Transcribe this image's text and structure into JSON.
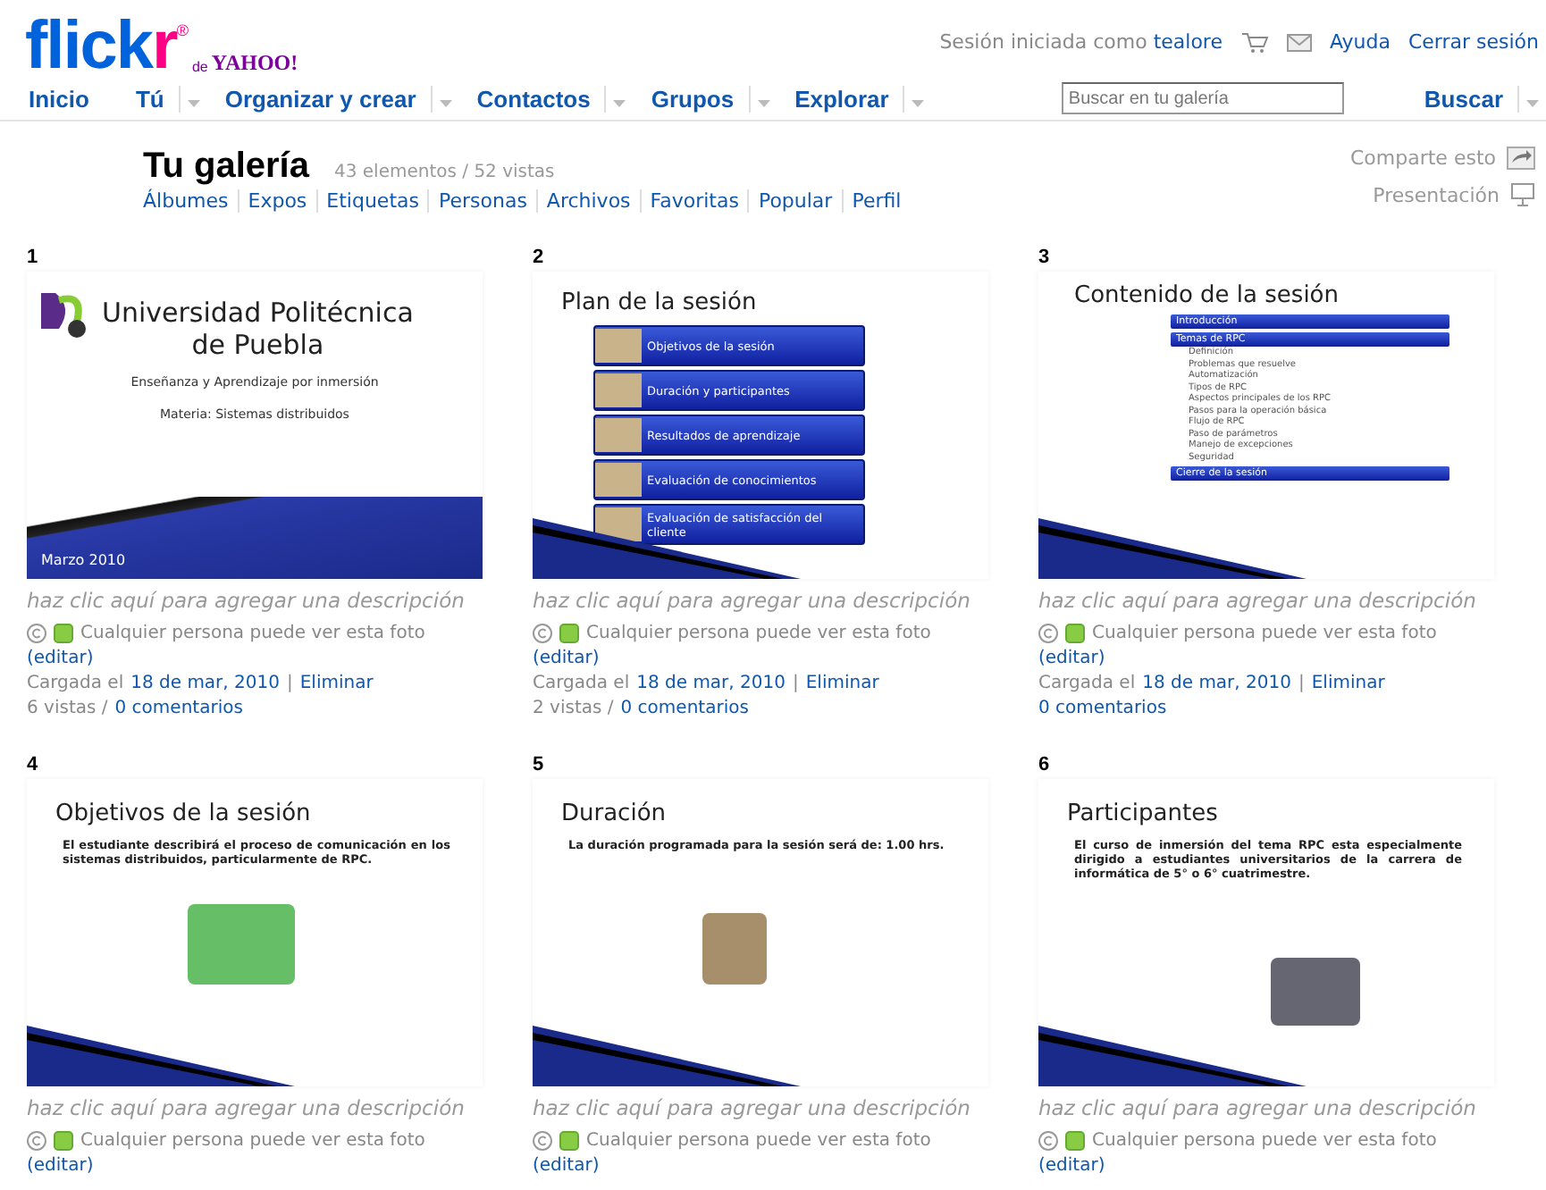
{
  "logo": {
    "word": "flick",
    "accent": "r",
    "mark": "®",
    "sub": "de",
    "brand": "YAHOO!"
  },
  "account": {
    "prefix": "Sesión iniciada como",
    "user": "tealore",
    "help": "Ayuda",
    "logout": "Cerrar sesión"
  },
  "nav": [
    {
      "label": "Inicio",
      "dropdown": false
    },
    {
      "label": "Tú",
      "dropdown": true
    },
    {
      "label": "Organizar y crear",
      "dropdown": true
    },
    {
      "label": "Contactos",
      "dropdown": true
    },
    {
      "label": "Grupos",
      "dropdown": true
    },
    {
      "label": "Explorar",
      "dropdown": true
    }
  ],
  "search": {
    "placeholder": "Buscar en tu galería",
    "button": "Buscar"
  },
  "gallery": {
    "title": "Tu galería",
    "stats": "43 elementos / 52 vistas",
    "share": "Comparte esto",
    "slideshow": "Presentación",
    "tabs": [
      {
        "label": "Álbumes",
        "selected": false
      },
      {
        "label": "Expos",
        "selected": false
      },
      {
        "label": "Etiquetas",
        "selected": false
      },
      {
        "label": "Personas",
        "selected": false
      },
      {
        "label": "Archivos",
        "selected": false
      },
      {
        "label": "Favoritas",
        "selected": false
      },
      {
        "label": "Popular",
        "selected": false
      },
      {
        "label": "Perfil",
        "selected": false
      }
    ]
  },
  "items": [
    {
      "number": "1",
      "slide": {
        "kind": "title",
        "heading": [
          "Universidad Politécnica",
          "de Puebla"
        ],
        "lines": [
          "Enseñanza y Aprendizaje  por inmersión",
          "Materia: Sistemas distribuidos"
        ],
        "footer": "Marzo 2010"
      },
      "description": "haz clic aquí para agregar una descripción",
      "license": "Cualquier persona puede ver esta foto",
      "edit": "(editar)",
      "uploaded": "Cargada el",
      "date": "18 de mar, 2010",
      "separator": "|",
      "delete": "Eliminar",
      "views": "6 vistas /",
      "comments": "0 comentarios"
    },
    {
      "number": "2",
      "slide": {
        "kind": "menu",
        "title": "Plan de la sesión",
        "entries": [
          "Objetivos de la sesión",
          "Duración  y participantes",
          "Resultados de aprendizaje",
          "Evaluación de conocimientos",
          "Evaluación de satisfacción del cliente"
        ]
      },
      "description": "haz clic aquí para agregar una descripción",
      "license": "Cualquier persona puede ver esta foto",
      "edit": "(editar)",
      "uploaded": "Cargada el",
      "date": "18 de mar, 2010",
      "separator": "|",
      "delete": "Eliminar",
      "views": "2 vistas /",
      "comments": "0 comentarios"
    },
    {
      "number": "3",
      "slide": {
        "kind": "outline",
        "title": "Contenido de la sesión",
        "sections": [
          {
            "label": "Introducción"
          },
          {
            "label": "Temas de RPC",
            "children": [
              "Definición",
              "Problemas que resuelve",
              "Automatización",
              "Tipos de RPC",
              "Aspectos principales de los RPC",
              "Pasos para la operación básica",
              "Flujo de RPC",
              "Paso de parámetros",
              "Manejo de excepciones",
              "Seguridad"
            ]
          },
          {
            "label": "Cierre de la sesión"
          }
        ]
      },
      "description": "haz clic aquí para agregar una descripción",
      "license": "Cualquier persona puede ver esta foto",
      "edit": "(editar)",
      "uploaded": "Cargada el",
      "date": "18 de mar, 2010",
      "separator": "|",
      "delete": "Eliminar",
      "comments": "0 comentarios"
    },
    {
      "number": "4",
      "slide": {
        "kind": "bullets",
        "title": "Objetivos de la sesión",
        "bullet": "El estudiante describirá el proceso de comunicación en los sistemas distribuidos, particularmente de RPC.",
        "picture": {
          "kind": "runners"
        }
      },
      "description": "haz clic aquí para agregar una descripción",
      "license": "Cualquier persona puede ver esta foto",
      "edit": "(editar)"
    },
    {
      "number": "5",
      "slide": {
        "kind": "bullets",
        "title": "Duración",
        "bullet": "La duración programada para la sesión será de: 1.00 hrs.",
        "picture": {
          "kind": "hourglass"
        }
      },
      "description": "haz clic aquí para agregar una descripción",
      "license": "Cualquier persona puede ver esta foto",
      "edit": "(editar)"
    },
    {
      "number": "6",
      "slide": {
        "kind": "bullets",
        "title": "Participantes",
        "bullet": "El curso de inmersión del tema RPC esta especialmente dirigido a estudiantes universitarios de la carrera de informática de 5° o 6° cuatrimestre.",
        "picture": {
          "kind": "cap"
        }
      },
      "description": "haz clic aquí para agregar una descripción",
      "license": "Cualquier persona puede ver esta foto",
      "edit": "(editar)"
    }
  ]
}
